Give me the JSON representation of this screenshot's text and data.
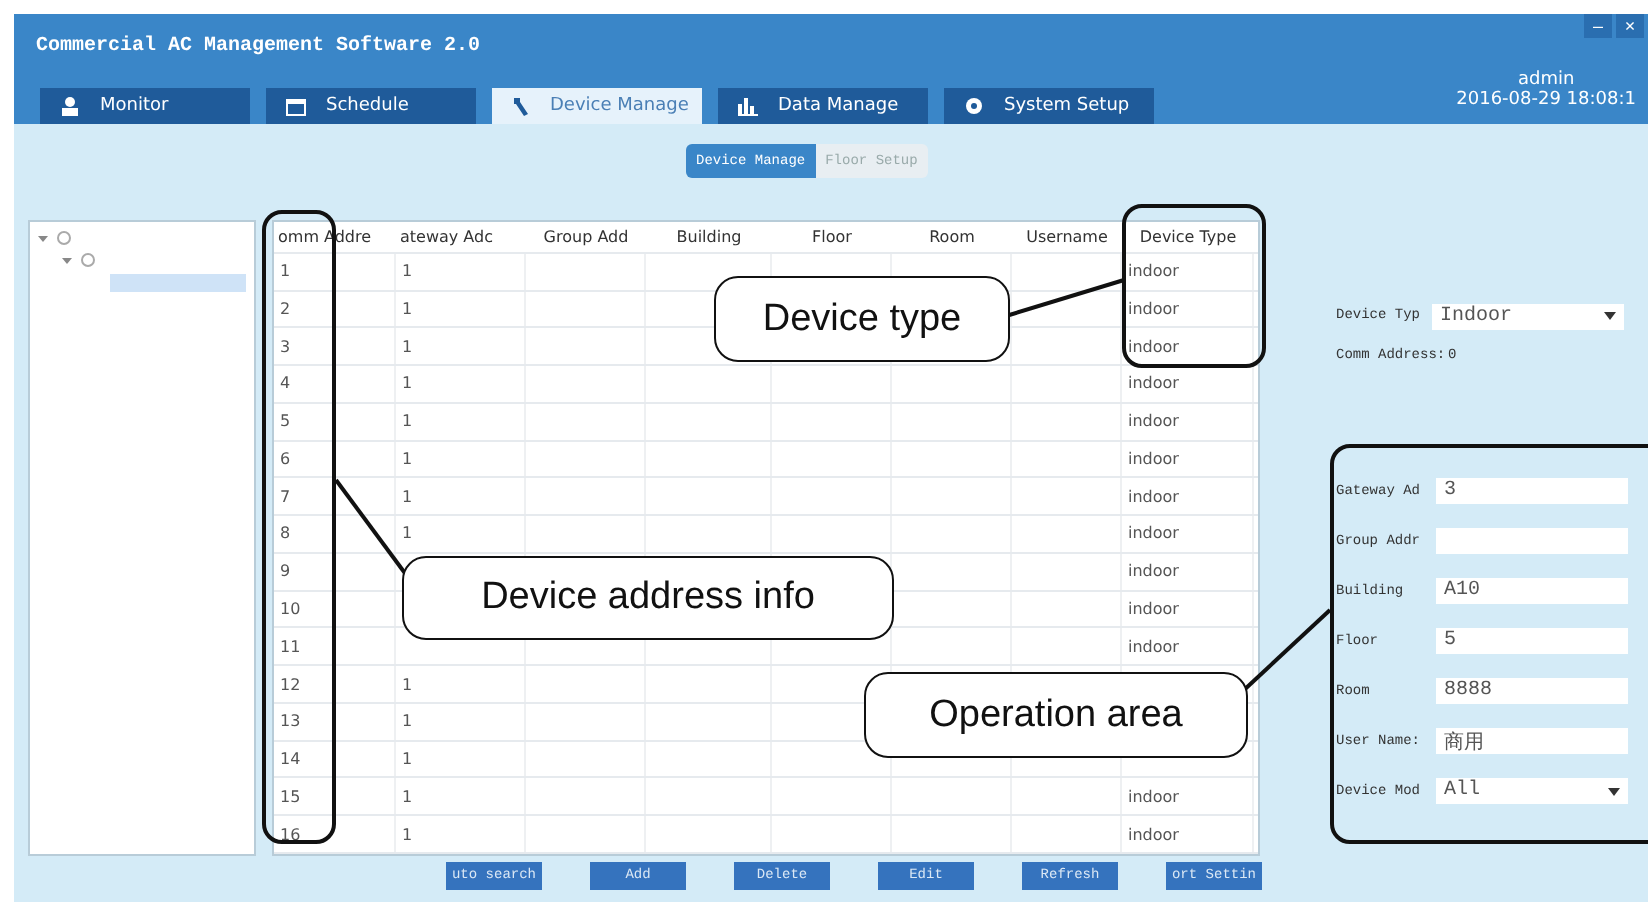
{
  "window": {
    "title": "Commercial AC Management Software 2.0",
    "controls": [
      "–",
      "×"
    ],
    "user": "admin",
    "datetime": "2016-08-29 18:08:1"
  },
  "tabs": [
    {
      "label": "Monitor",
      "selected": false
    },
    {
      "label": "Schedule",
      "selected": false
    },
    {
      "label": "Device Manage",
      "selected": true
    },
    {
      "label": "Data Manage",
      "selected": false
    },
    {
      "label": "System Setup",
      "selected": false
    }
  ],
  "subtabs": [
    {
      "label": "Device Manage",
      "selected": true
    },
    {
      "label": "Floor Setup",
      "selected": false
    }
  ],
  "tree": [
    {
      "expanded": true,
      "selected": false,
      "children": [
        {
          "expanded": true,
          "selected": false,
          "children": [
            {
              "selected": true
            }
          ]
        }
      ]
    }
  ],
  "table": {
    "columns": [
      "omm Addre",
      "ateway Adc",
      "Group Add",
      "Building",
      "Floor",
      "Room",
      "Username",
      "Device Type"
    ],
    "rows": [
      [
        "1",
        "1",
        "",
        "",
        "",
        "",
        "",
        "indoor"
      ],
      [
        "2",
        "1",
        "",
        "",
        "",
        "",
        "",
        "indoor"
      ],
      [
        "3",
        "1",
        "",
        "",
        "",
        "",
        "",
        "indoor"
      ],
      [
        "4",
        "1",
        "",
        "",
        "",
        "",
        "",
        "indoor"
      ],
      [
        "5",
        "1",
        "",
        "",
        "",
        "",
        "",
        "indoor"
      ],
      [
        "6",
        "1",
        "",
        "",
        "",
        "",
        "",
        "indoor"
      ],
      [
        "7",
        "1",
        "",
        "",
        "",
        "",
        "",
        "indoor"
      ],
      [
        "8",
        "1",
        "",
        "",
        "",
        "",
        "",
        "indoor"
      ],
      [
        "9",
        "",
        "",
        "",
        "",
        "",
        "",
        "indoor"
      ],
      [
        "10",
        "",
        "",
        "",
        "",
        "",
        "",
        "indoor"
      ],
      [
        "11",
        "",
        "",
        "",
        "",
        "",
        "",
        "indoor"
      ],
      [
        "12",
        "1",
        "",
        "",
        "",
        "",
        "",
        ""
      ],
      [
        "13",
        "1",
        "",
        "",
        "",
        "",
        "",
        ""
      ],
      [
        "14",
        "1",
        "",
        "",
        "",
        "",
        "",
        ""
      ],
      [
        "15",
        "1",
        "",
        "",
        "",
        "",
        "",
        "indoor"
      ],
      [
        "16",
        "1",
        "",
        "",
        "",
        "",
        "",
        "indoor"
      ]
    ]
  },
  "settings": [
    {
      "kind": "select",
      "label": "Device Typ",
      "value": "Indoor"
    },
    {
      "kind": "text",
      "label": "Comm Address:",
      "value": "0"
    }
  ],
  "operation_fields": [
    {
      "kind": "input",
      "label": "Gateway Ad",
      "value": "3"
    },
    {
      "kind": "input",
      "label": "Group Addr"
    },
    {
      "kind": "input",
      "label": "Building",
      "value": "A10"
    },
    {
      "kind": "input",
      "label": "Floor",
      "value": "5"
    },
    {
      "kind": "input",
      "label": "Room",
      "value": "8888"
    },
    {
      "kind": "input",
      "label": "User Name:",
      "value": "商用"
    },
    {
      "kind": "select",
      "label": "Device Mod",
      "value": "All"
    }
  ],
  "buttons": [
    "uto search",
    "Add",
    "Delete",
    "Edit",
    "Refresh",
    "ort Settin"
  ],
  "callouts": [
    {
      "text": "Device type"
    },
    {
      "text": "Device address info"
    },
    {
      "text": "Operation area"
    }
  ]
}
